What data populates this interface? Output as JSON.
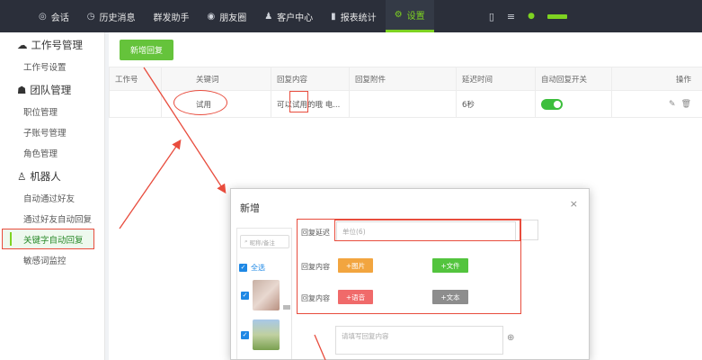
{
  "nav": {
    "items": [
      {
        "icon": "chat-icon",
        "label": "会话"
      },
      {
        "icon": "clock-icon",
        "label": "历史消息"
      },
      {
        "icon": "",
        "label": "群发助手"
      },
      {
        "icon": "moments-icon",
        "label": "朋友圈"
      },
      {
        "icon": "user-icon",
        "label": "客户中心"
      },
      {
        "icon": "bar-chart-icon",
        "label": "报表统计"
      },
      {
        "icon": "gear-icon",
        "label": "设置"
      }
    ],
    "active": "设置",
    "accent": "#7ed321"
  },
  "sidebar": {
    "groups": [
      {
        "icon": "wechat-icon",
        "label": "工作号管理",
        "items": [
          "工作号设置"
        ]
      },
      {
        "icon": "team-icon",
        "label": "团队管理",
        "items": [
          "职位管理",
          "子账号管理",
          "角色管理"
        ]
      },
      {
        "icon": "robot-icon",
        "label": "机器人",
        "items": [
          "自动通过好友",
          "通过好友自动回复",
          "关键字自动回复",
          "敏感词监控"
        ]
      }
    ],
    "active_item": "关键字自动回复"
  },
  "main": {
    "add_button": "新增回复",
    "table": {
      "headers": [
        "工作号",
        "关键词",
        "回复内容",
        "回复附件",
        "延迟时间",
        "自动回复开关",
        "操作"
      ],
      "rows": [
        {
          "account": "",
          "keyword": "试用",
          "content": "可以试用的哦 电...",
          "attachment": "",
          "delay": "6秒",
          "switch_on": true
        }
      ]
    }
  },
  "modal": {
    "title": "新增",
    "close": "×",
    "search_placeholder": "昵称/备注",
    "select_all": "全选",
    "delay_label": "回复延迟",
    "delay_placeholder": "单位(6)",
    "content_label_1": "回复内容",
    "content_label_2": "回复内容",
    "btn_image": "+图片",
    "btn_file": "+文件",
    "btn_voice": "+语音",
    "btn_text": "+文本",
    "reply_placeholder": "请填写回复内容",
    "colors": {
      "image": "#f2a53f",
      "file": "#53c43e",
      "voice": "#f06a6a",
      "text": "#8d8d8d"
    }
  }
}
